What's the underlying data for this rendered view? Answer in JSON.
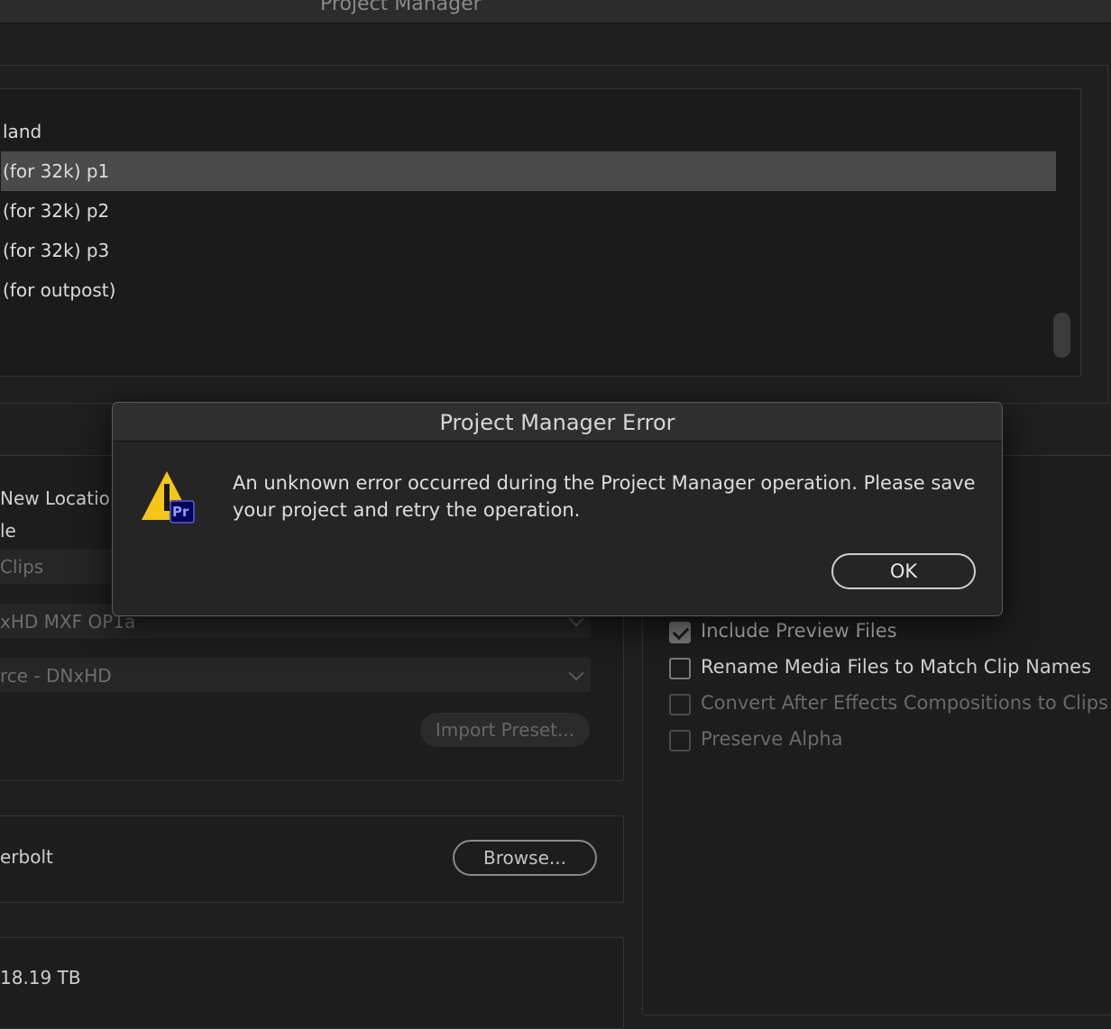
{
  "window": {
    "title": "Project Manager"
  },
  "sequences": [
    {
      "label": "land",
      "selected": false
    },
    {
      "label": "(for 32k) p1",
      "selected": true
    },
    {
      "label": "(for 32k) p2",
      "selected": false
    },
    {
      "label": "(for 32k) p3",
      "selected": false
    },
    {
      "label": "(for outpost)",
      "selected": false
    }
  ],
  "resulting": {
    "option_new_location": "New Locatio",
    "option_file": "le",
    "option_clips": "Clips",
    "format": "xHD MXF OP1a",
    "preset": "rce - DNxHD",
    "import_preset": "Import Preset..."
  },
  "options": [
    {
      "label": "Include Preview Files",
      "checked": true,
      "enabled": true
    },
    {
      "label": "Rename Media Files to Match Clip Names",
      "checked": false,
      "enabled": true
    },
    {
      "label": "Convert After Effects Compositions to Clips",
      "checked": false,
      "enabled": false
    },
    {
      "label": "Preserve Alpha",
      "checked": false,
      "enabled": false
    }
  ],
  "destination": {
    "path": "erbolt",
    "browse": "Browse..."
  },
  "disk": {
    "available": "18.19 TB"
  },
  "dialog": {
    "title": "Project Manager Error",
    "message": "An unknown error occurred during the Project Manager operation. Please save your project and retry the operation.",
    "ok": "OK",
    "badge": "Pr",
    "icon": "warning-icon"
  }
}
